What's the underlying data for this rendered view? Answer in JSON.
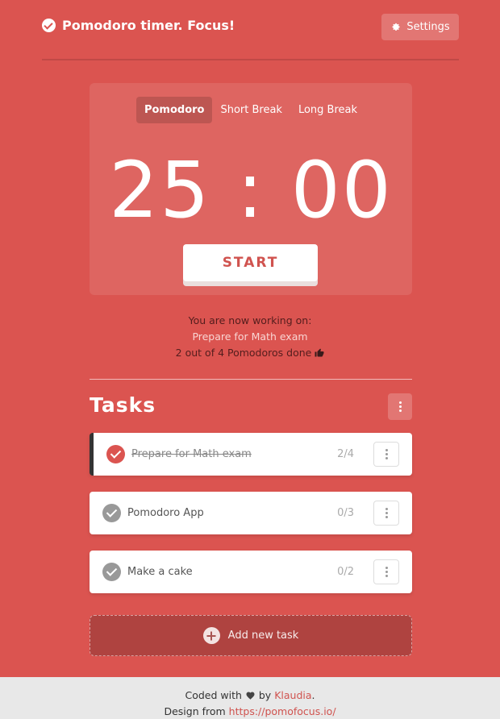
{
  "header": {
    "title": "Pomodoro timer. Focus!",
    "settings_label": "Settings"
  },
  "timer": {
    "modes": [
      "Pomodoro",
      "Short Break",
      "Long Break"
    ],
    "active_mode": "Pomodoro",
    "display": "25 : 00",
    "start_label": "START"
  },
  "working": {
    "label": "You are now working on:",
    "current_task": "Prepare for Math exam",
    "progress_text": "2 out of 4 Pomodoros done"
  },
  "tasks": {
    "title": "Tasks",
    "items": [
      {
        "name": "Prepare for Math exam",
        "count": "2/4",
        "active": true
      },
      {
        "name": "Pomodoro App",
        "count": "0/3",
        "active": false
      },
      {
        "name": "Make a cake",
        "count": "0/2",
        "active": false
      }
    ],
    "add_label": "Add new task"
  },
  "footer": {
    "coded_with": "Coded with",
    "by": "by",
    "author": "Klaudia",
    "period": ".",
    "design_from": "Design from",
    "design_url": "https://pomofocus.io/"
  },
  "colors": {
    "background": "#db5450",
    "accent_text": "#d0534f",
    "footer_bg": "#e8e8e8"
  }
}
